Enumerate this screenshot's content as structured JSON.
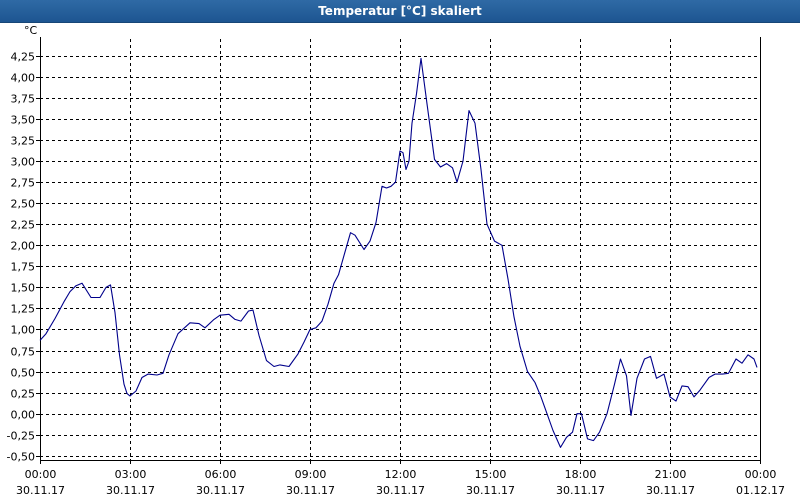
{
  "window": {
    "title": "Temperatur [°C] skaliert"
  },
  "chart_data": {
    "type": "line",
    "title": "Temperatur [°C] skaliert",
    "y_unit": "°C",
    "xlabel": "",
    "ylabel": "°C",
    "ylim": [
      -0.55,
      4.45
    ],
    "xlim": [
      0,
      24
    ],
    "grid": true,
    "line_color": "#00008b",
    "y_ticks": [
      -0.5,
      -0.25,
      0,
      0.25,
      0.5,
      0.75,
      1,
      1.25,
      1.5,
      1.75,
      2,
      2.25,
      2.5,
      2.75,
      3,
      3.25,
      3.5,
      3.75,
      4,
      4.25
    ],
    "y_tick_labels": [
      "-0,50",
      "-0,25",
      "0,00",
      "0,25",
      "0,50",
      "0,75",
      "1,00",
      "1,25",
      "1,50",
      "1,75",
      "2,00",
      "2,25",
      "2,50",
      "2,75",
      "3,00",
      "3,25",
      "3,50",
      "3,75",
      "4,00",
      "4,25"
    ],
    "x_ticks": [
      0,
      3,
      6,
      9,
      12,
      15,
      18,
      21,
      24
    ],
    "x_tick_labels": [
      {
        "time": "00:00",
        "date": "30.11.17"
      },
      {
        "time": "03:00",
        "date": "30.11.17"
      },
      {
        "time": "06:00",
        "date": "30.11.17"
      },
      {
        "time": "09:00",
        "date": "30.11.17"
      },
      {
        "time": "12:00",
        "date": "30.11.17"
      },
      {
        "time": "15:00",
        "date": "30.11.17"
      },
      {
        "time": "18:00",
        "date": "30.11.17"
      },
      {
        "time": "21:00",
        "date": "30.11.17"
      },
      {
        "time": "00:00",
        "date": "01.12.17"
      }
    ],
    "series": [
      {
        "x": [
          0,
          0.2,
          0.5,
          0.8,
          1.0,
          1.2,
          1.4,
          1.7,
          2.0,
          2.2,
          2.35,
          2.5,
          2.65,
          2.8,
          2.9,
          3.0,
          3.2,
          3.4,
          3.6,
          3.9,
          4.1,
          4.3,
          4.6,
          5.0,
          5.3,
          5.5,
          5.8,
          6.0,
          6.3,
          6.5,
          6.7,
          6.95,
          7.1,
          7.3,
          7.55,
          7.8,
          8.0,
          8.3,
          8.6,
          8.8,
          9.0,
          9.2,
          9.4,
          9.6,
          9.8,
          9.95,
          10.15,
          10.35,
          10.5,
          10.8,
          11.0,
          11.2,
          11.4,
          11.55,
          11.7,
          11.85,
          12.0,
          12.1,
          12.2,
          12.3,
          12.4,
          12.55,
          12.7,
          12.9,
          13.15,
          13.35,
          13.55,
          13.75,
          13.9,
          14.1,
          14.3,
          14.5,
          14.7,
          14.9,
          15.15,
          15.4,
          15.6,
          15.8,
          16.0,
          16.25,
          16.5,
          16.7,
          16.9,
          17.1,
          17.35,
          17.55,
          17.75,
          17.9,
          18.05,
          18.25,
          18.45,
          18.65,
          18.9,
          19.15,
          19.35,
          19.55,
          19.7,
          19.9,
          20.15,
          20.35,
          20.55,
          20.8,
          21.0,
          21.2,
          21.4,
          21.6,
          21.8,
          22.0,
          22.3,
          22.5,
          22.75,
          22.95,
          23.2,
          23.4,
          23.6,
          23.8,
          23.9
        ],
        "y": [
          0.87,
          0.95,
          1.13,
          1.33,
          1.45,
          1.52,
          1.55,
          1.38,
          1.38,
          1.5,
          1.53,
          1.2,
          0.7,
          0.35,
          0.24,
          0.21,
          0.27,
          0.43,
          0.47,
          0.46,
          0.48,
          0.7,
          0.95,
          1.08,
          1.07,
          1.02,
          1.12,
          1.17,
          1.18,
          1.12,
          1.1,
          1.22,
          1.23,
          0.93,
          0.63,
          0.56,
          0.58,
          0.56,
          0.71,
          0.85,
          1.0,
          1.02,
          1.1,
          1.3,
          1.55,
          1.65,
          1.9,
          2.15,
          2.12,
          1.95,
          2.05,
          2.27,
          2.7,
          2.68,
          2.7,
          2.75,
          3.12,
          3.1,
          2.9,
          3.0,
          3.45,
          3.8,
          4.22,
          3.68,
          3.02,
          2.93,
          2.97,
          2.92,
          2.75,
          3.0,
          3.6,
          3.45,
          2.9,
          2.25,
          2.05,
          2.0,
          1.6,
          1.15,
          0.8,
          0.5,
          0.37,
          0.2,
          0.0,
          -0.2,
          -0.4,
          -0.28,
          -0.22,
          0.0,
          0.0,
          -0.3,
          -0.32,
          -0.22,
          0.0,
          0.35,
          0.65,
          0.45,
          -0.02,
          0.42,
          0.65,
          0.68,
          0.42,
          0.47,
          0.2,
          0.15,
          0.33,
          0.32,
          0.2,
          0.28,
          0.43,
          0.47,
          0.47,
          0.48,
          0.65,
          0.6,
          0.7,
          0.65,
          0.55
        ]
      }
    ]
  }
}
